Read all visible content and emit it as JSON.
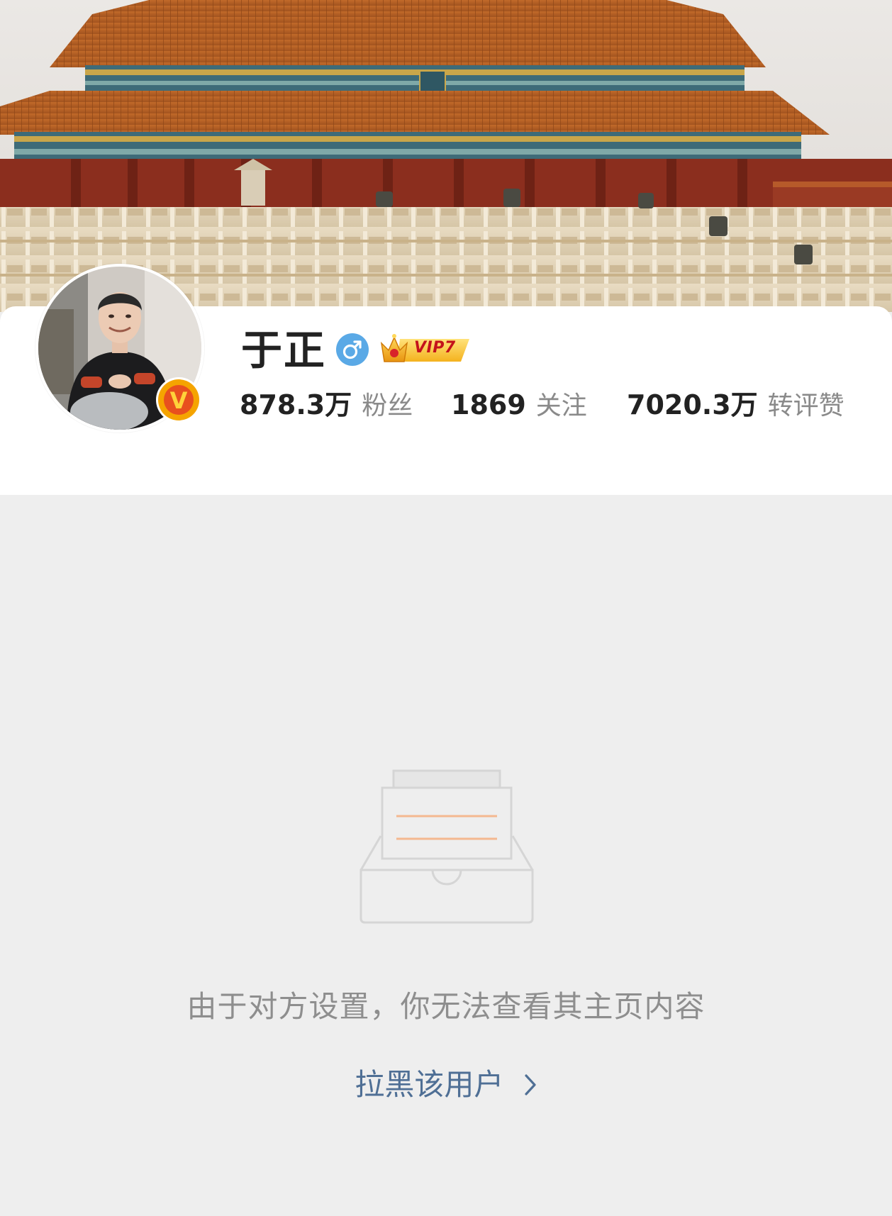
{
  "profile": {
    "name": "于正",
    "gender_icon": "male-symbol-icon",
    "vip_label": "VIP7",
    "verified_badge_letter": "V",
    "stats": [
      {
        "value": "878.3万",
        "label": "粉丝"
      },
      {
        "value": "1869",
        "label": "关注"
      },
      {
        "value": "7020.3万",
        "label": "转评赞"
      }
    ]
  },
  "content": {
    "notice": "由于对方设置，你无法查看其主页内容",
    "block_link": "拉黑该用户",
    "empty_icon": "empty-inbox-icon"
  },
  "colors": {
    "background": "#eeeeee",
    "card": "#ffffff",
    "link": "#4f6f95",
    "muted_text": "#8e8e8e",
    "verify_badge": "#f5a400",
    "gender_badge": "#5aa9e6"
  }
}
